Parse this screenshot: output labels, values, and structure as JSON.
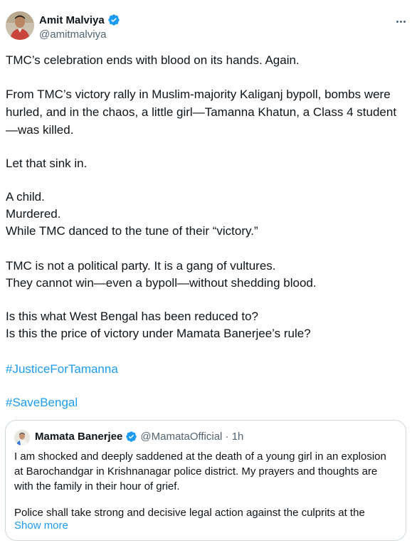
{
  "author": {
    "name": "Amit Malviya",
    "handle": "@amitmalviya"
  },
  "tweet": {
    "line1": "TMC’s celebration ends with blood on its hands. Again.",
    "line2a": "From TMC’s victory rally in Muslim-majority Kaliganj bypoll, bombs were",
    "line2b": "hurled, and in the chaos, a little girl—Tamanna Khatun, a Class 4 student",
    "line2c": "—was killed.",
    "line3": "Let that sink in.",
    "line4a": "A child.",
    "line4b": "Murdered.",
    "line4c": "While TMC danced to the tune of their “victory.”",
    "line5a": "TMC is not a political party. It is a gang of vultures.",
    "line5b": "They cannot win—even a bypoll—without shedding blood.",
    "line6a": "Is this what West Bengal has been reduced to?",
    "line6b": "Is this the price of victory under Mamata Banerjee’s rule?",
    "hashtag1": "#JusticeForTamanna",
    "hashtag2": "#SaveBengal"
  },
  "quote": {
    "name": "Mamata Banerjee",
    "handle_time": "@MamataOfficial · 1h",
    "line1": "I am shocked and deeply saddened at the death of a young girl in an explosion",
    "line2": "at Barochandgar in Krishnanagar police district. My prayers and thoughts are",
    "line3": "with the family in their hour of grief.",
    "line4": "Police shall take strong and decisive legal action against the culprits at the",
    "show_more": "Show more"
  },
  "colors": {
    "link": "#1d9bf0",
    "verified": "#1d9bf0",
    "secondary_text": "#536471",
    "border": "#cfd9de"
  },
  "icons": [
    "verified-badge-icon",
    "more-options-icon"
  ]
}
